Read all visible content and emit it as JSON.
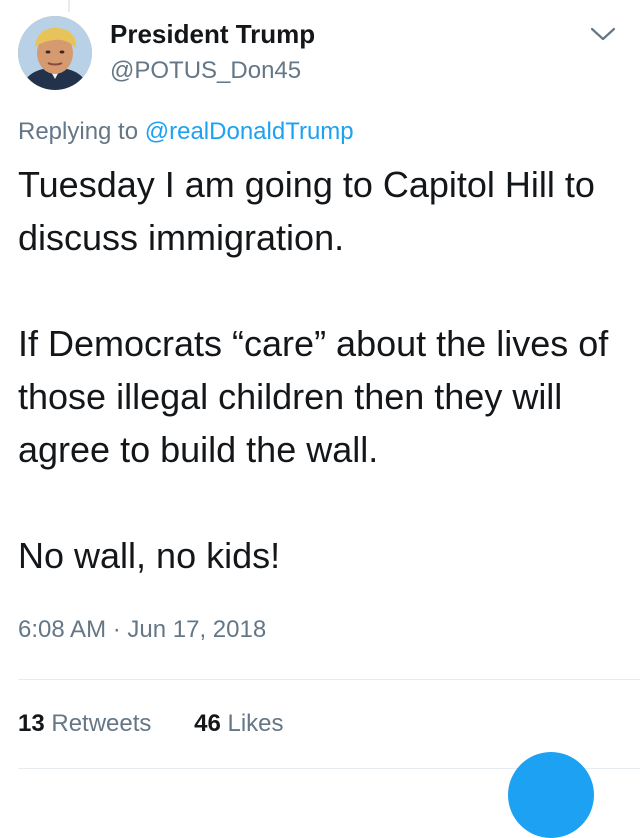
{
  "author": {
    "display_name": "President Trump",
    "handle": "@POTUS_Don45"
  },
  "reply": {
    "prefix": "Replying to ",
    "mention": "@realDonaldTrump"
  },
  "tweet": {
    "paragraphs": [
      "Tuesday I am going to Capitol Hill to discuss immigration.",
      "If Democrats “care” about the lives of those illegal children then they will agree to build the wall.",
      "No wall, no kids!"
    ],
    "timestamp": "6:08 AM · Jun 17, 2018"
  },
  "stats": {
    "retweets_count": "13",
    "retweets_label": "Retweets",
    "likes_count": "46",
    "likes_label": "Likes"
  },
  "icons": {
    "menu": "chevron-down-icon",
    "avatar": "avatar",
    "compose": "compose-button"
  },
  "colors": {
    "accent": "#1da1f2",
    "text_primary": "#14171a",
    "text_secondary": "#657786",
    "divider": "#e6ecf0"
  }
}
